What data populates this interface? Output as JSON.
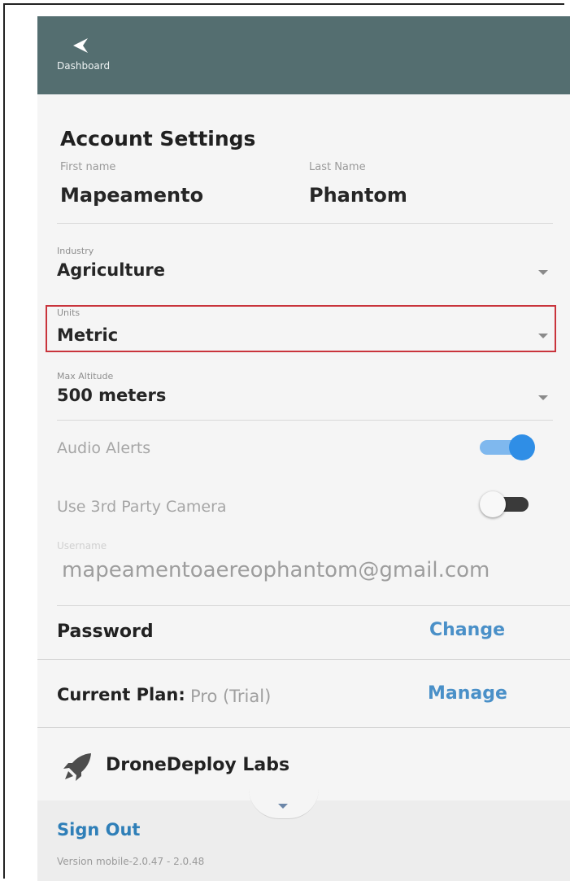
{
  "header": {
    "back_label": "Dashboard",
    "background": "#546e70"
  },
  "account": {
    "title": "Account Settings",
    "first_name_label": "First name",
    "first_name_value": "Mapeamento",
    "last_name_label": "Last Name",
    "last_name_value": "Phantom"
  },
  "industry": {
    "label": "Industry",
    "value": "Agriculture"
  },
  "units": {
    "label": "Units",
    "value": "Metric",
    "highlight_color": "#c9343c"
  },
  "max_altitude": {
    "label": "Max Altitude",
    "value": "500 meters"
  },
  "audio_alerts": {
    "label": "Audio Alerts",
    "on": true
  },
  "third_party_camera": {
    "label": "Use 3rd Party Camera",
    "on": false
  },
  "username": {
    "label": "Username",
    "value": "mapeamentoaereophantom@gmail.com"
  },
  "password": {
    "label": "Password",
    "action": "Change"
  },
  "plan": {
    "label": "Current Plan:",
    "value": "Pro (Trial)",
    "action": "Manage"
  },
  "labs": {
    "label": "DroneDeploy Labs"
  },
  "footer": {
    "sign_out": "Sign Out",
    "version": "Version mobile-2.0.47 - 2.0.48"
  },
  "colors": {
    "accent": "#2f8ee6",
    "link": "#4a90c8"
  }
}
